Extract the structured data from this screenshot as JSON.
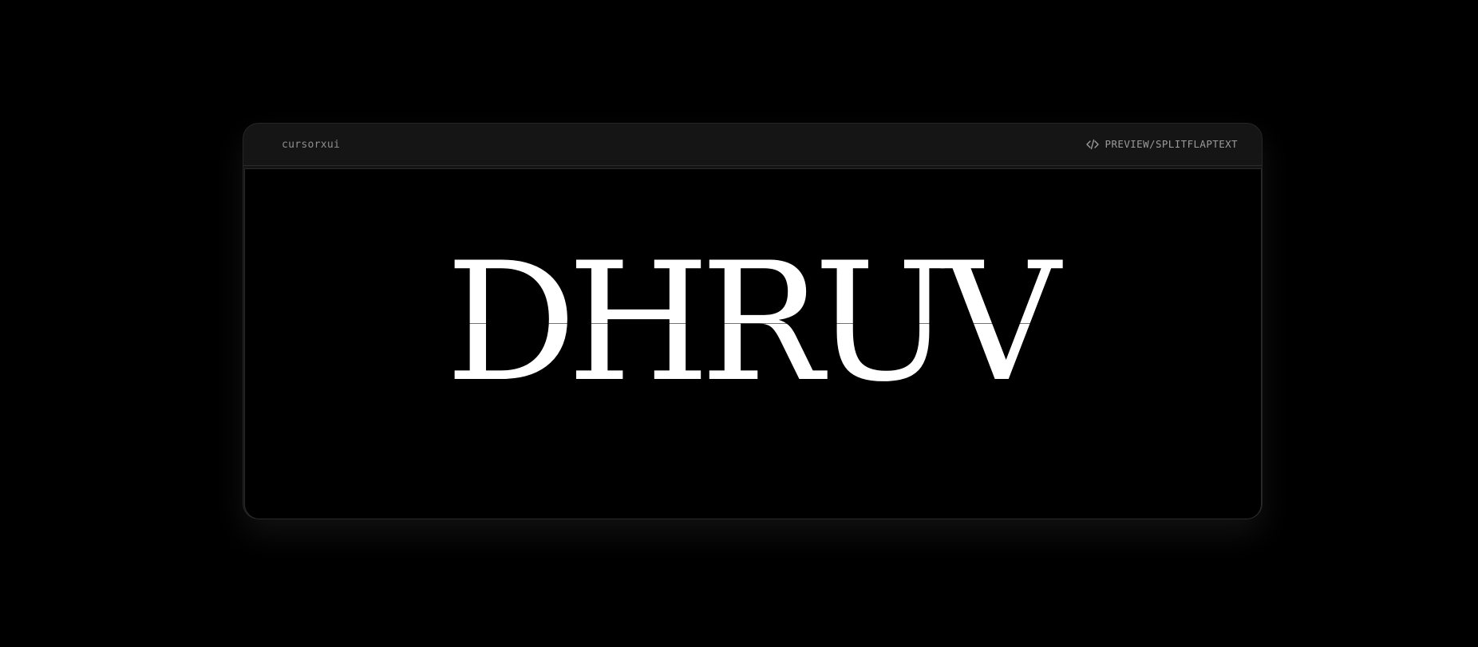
{
  "window": {
    "brand": "cursorxui",
    "route": "PREVIEW/SPLITFLAPTEXT",
    "route_icon": "code-icon"
  },
  "preview": {
    "letters": [
      "D",
      "H",
      "R",
      "U",
      "V"
    ]
  },
  "colors": {
    "background": "#000000",
    "panel": "#151515",
    "text_muted": "#9b9b9b",
    "letters": "#ffffff"
  }
}
